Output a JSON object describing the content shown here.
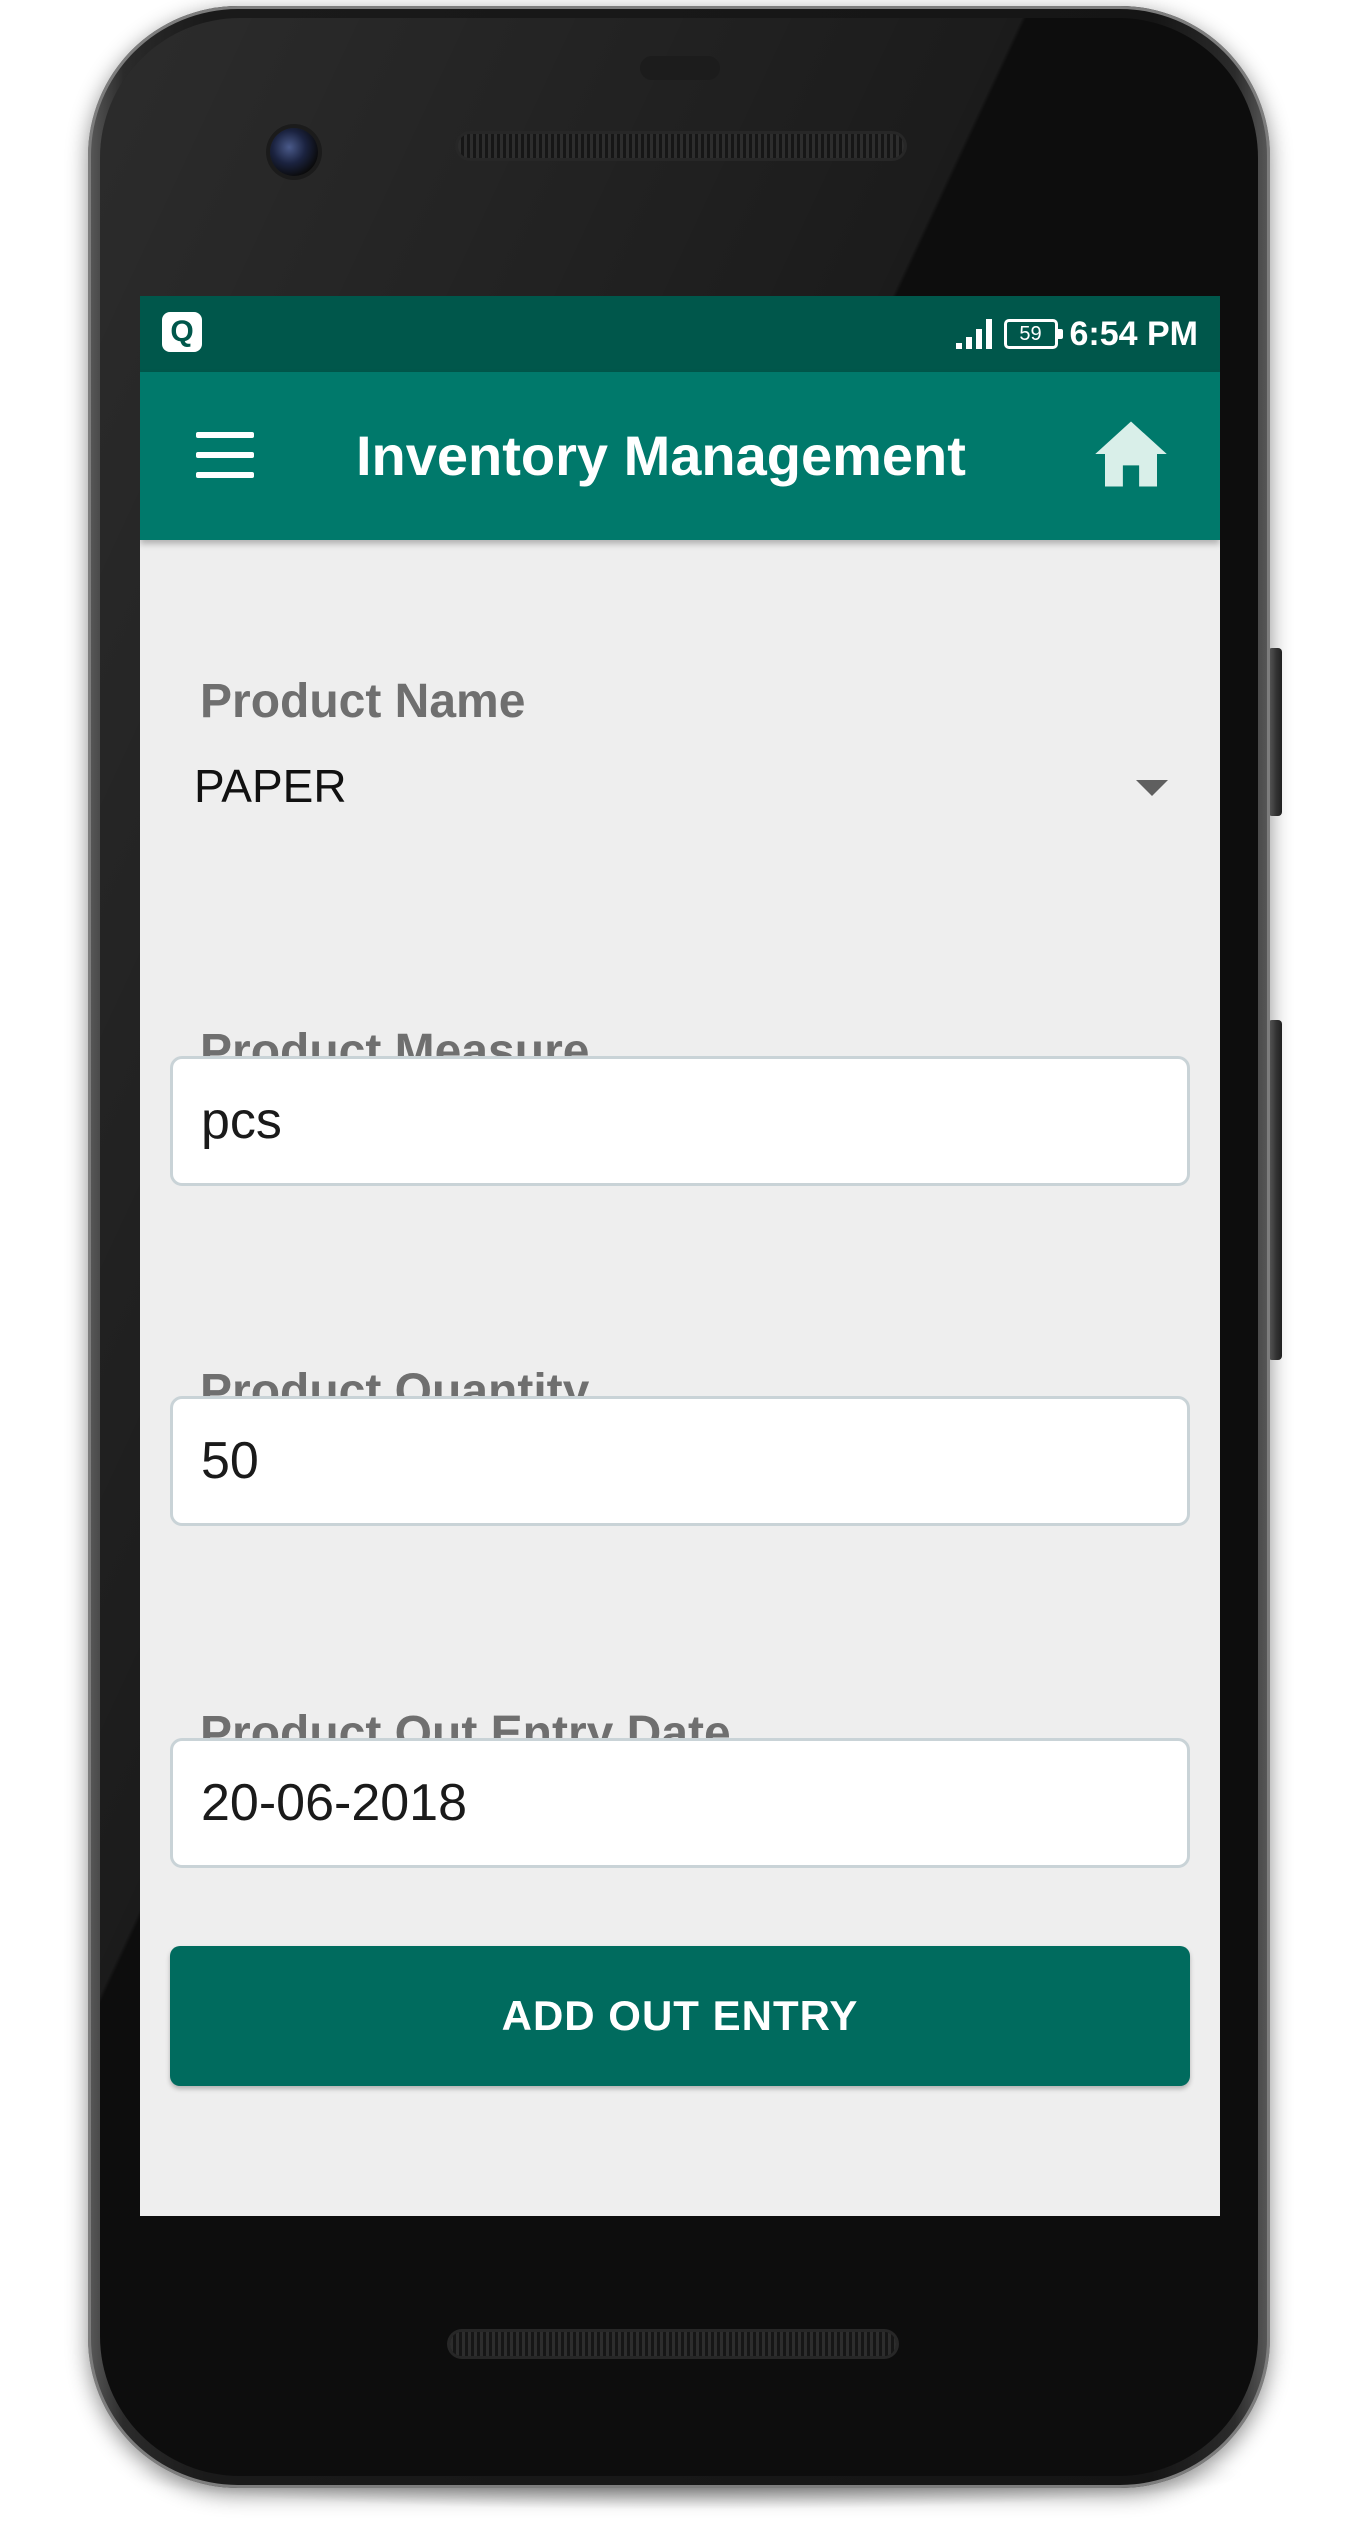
{
  "status_bar": {
    "app_icon_letter": "Q",
    "battery_level": "59",
    "time": "6:54 PM",
    "background_color": "#00574b"
  },
  "app_bar": {
    "title": "Inventory Management",
    "menu_icon": "hamburger-menu-icon",
    "home_icon": "home-icon",
    "background_color": "#00796b"
  },
  "form": {
    "product_name": {
      "label": "Product Name",
      "selected_value": "PAPER"
    },
    "product_measure": {
      "label": "Product Measure",
      "value": "pcs"
    },
    "product_quantity": {
      "label": "Product Quantity",
      "value": "50"
    },
    "product_out_entry_date": {
      "label": "Product Out Entry Date",
      "value": "20-06-2018"
    },
    "submit_label": "ADD OUT ENTRY",
    "button_color": "#006b5e"
  }
}
